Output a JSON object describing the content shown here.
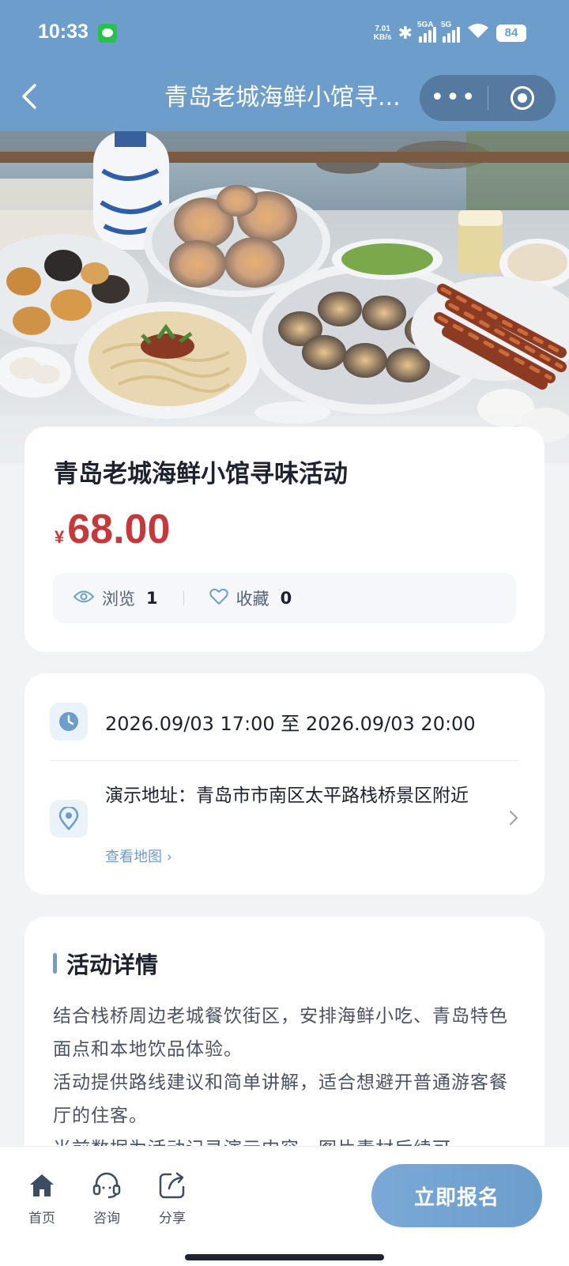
{
  "status_bar": {
    "time": "10:33",
    "speed": "7.01\nKB/s",
    "speed_value": "7.01",
    "speed_unit": "KB/s",
    "network_1": "5GA",
    "network_2": "5G",
    "battery": "84"
  },
  "nav": {
    "title": "青岛老城海鲜小馆寻...",
    "more_icon": "more-dots-icon",
    "close_icon": "target-circle-icon"
  },
  "activity": {
    "title": "青岛老城海鲜小馆寻味活动",
    "currency": "¥",
    "price": "68.00",
    "views_label": "浏览",
    "views": "1",
    "favorites_label": "收藏",
    "favorites": "0"
  },
  "info": {
    "time": "2026.09/03 17:00 至 2026.09/03 20:00",
    "address": "演示地址：青岛市市南区太平路栈桥景区附近",
    "map_link": "查看地图 ›"
  },
  "detail": {
    "section_title": "活动详情",
    "paragraphs": [
      "结合栈桥周边老城餐饮街区，安排海鲜小吃、青岛特色面点和本地饮品体验。",
      "活动提供路线建议和简单讲解，适合想避开普通游客餐厅的住客。",
      "当前数据为活动记录演示内容，图片素材后续可"
    ]
  },
  "bottom": {
    "home_label": "首页",
    "consult_label": "咨询",
    "share_label": "分享",
    "cta_label": "立即报名"
  },
  "colors": {
    "primary": "#6c9dcb",
    "price": "#c6383a",
    "background": "#f2f3f5"
  }
}
